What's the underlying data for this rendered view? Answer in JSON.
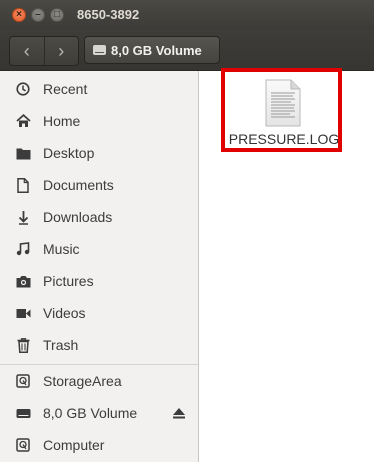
{
  "window": {
    "title": "8650-3892",
    "buttons": {
      "close": "×",
      "minimize": "–",
      "maximize": "□"
    }
  },
  "toolbar": {
    "back_icon": "chevron-left",
    "forward_icon": "chevron-right",
    "back_glyph": "‹",
    "forward_glyph": "›",
    "location": "8,0 GB Volume"
  },
  "sidebar": {
    "items": [
      {
        "label": "Recent",
        "icon": "clock-icon"
      },
      {
        "label": "Home",
        "icon": "home-icon"
      },
      {
        "label": "Desktop",
        "icon": "folder-icon"
      },
      {
        "label": "Documents",
        "icon": "document-icon"
      },
      {
        "label": "Downloads",
        "icon": "download-icon"
      },
      {
        "label": "Music",
        "icon": "music-icon"
      },
      {
        "label": "Pictures",
        "icon": "camera-icon"
      },
      {
        "label": "Videos",
        "icon": "video-icon"
      },
      {
        "label": "Trash",
        "icon": "trash-icon"
      }
    ],
    "devices": [
      {
        "label": "StorageArea",
        "icon": "drive-icon"
      },
      {
        "label": "8,0 GB Volume",
        "icon": "usb-drive-icon",
        "eject": true
      },
      {
        "label": "Computer",
        "icon": "computer-icon"
      }
    ]
  },
  "files": [
    {
      "name": "PRESSURE.LOG",
      "icon": "text-file-icon",
      "highlighted": true
    }
  ],
  "colors": {
    "titlebar": "#3c3b37",
    "sidebar_bg": "#f2f1f0",
    "highlight": "#e00000"
  }
}
